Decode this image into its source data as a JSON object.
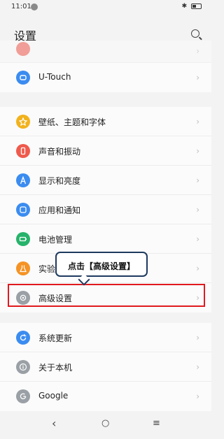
{
  "status": {
    "time": "11:01",
    "icons": "✱ ▮▮"
  },
  "header": {
    "title": "设置"
  },
  "colors": {
    "utouch": "#3b8cf0",
    "wallpaper": "#f2b21c",
    "sound": "#ef5a4c",
    "display": "#3b8cf0",
    "apps": "#3b8cf0",
    "battery": "#27b36b",
    "lab": "#f59324",
    "advanced": "#9aa0a6",
    "update": "#3b8cf0",
    "about": "#9aa0a6",
    "google": "#9aa0a6",
    "highlight": "#e0191f",
    "tooltip_border": "#1e3a5f"
  },
  "groups": [
    {
      "items": [
        {
          "label": "",
          "icon": "clock-icon"
        },
        {
          "label": "U-Touch",
          "icon": "touch-icon"
        }
      ]
    },
    {
      "items": [
        {
          "label": "壁纸、主题和字体",
          "icon": "theme-icon"
        },
        {
          "label": "声音和振动",
          "icon": "vibrate-icon"
        },
        {
          "label": "显示和亮度",
          "icon": "display-icon"
        },
        {
          "label": "应用和通知",
          "icon": "apps-icon"
        },
        {
          "label": "电池管理",
          "icon": "battery-icon"
        },
        {
          "label": "实验",
          "icon": "flask-icon"
        },
        {
          "label": "高级设置",
          "icon": "gear-icon"
        }
      ]
    },
    {
      "items": [
        {
          "label": "系统更新",
          "icon": "update-icon"
        },
        {
          "label": "关于本机",
          "icon": "info-icon"
        },
        {
          "label": "Google",
          "icon": "google-icon"
        }
      ]
    }
  ],
  "tooltip": {
    "text": "点击【高级设置】"
  },
  "nav": {
    "back": "‹",
    "home": "○",
    "recents": "≡"
  }
}
